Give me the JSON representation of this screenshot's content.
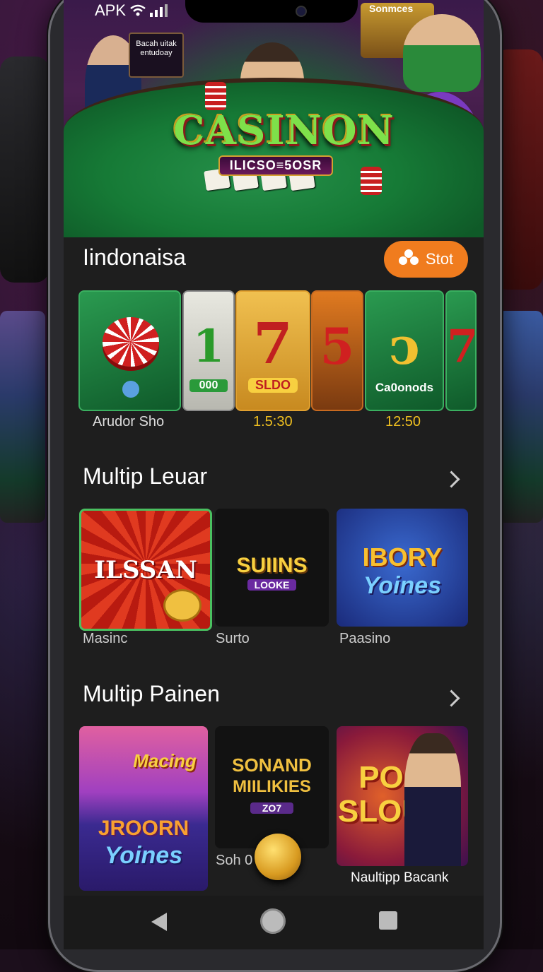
{
  "status_bar": {
    "label": "APK"
  },
  "hero": {
    "logo_title": "CASINON",
    "logo_subtitle": "ILICSO≡5OSR",
    "sign_left": "Bacah uitak entudoay",
    "sign_right": "Sonmces"
  },
  "section1": {
    "title": "Iindonaisa",
    "action_label": "Stot",
    "tiles": [
      {
        "caption_inner": "",
        "label": "Arudor Sho"
      },
      {
        "caption_inner": "000",
        "label": ""
      },
      {
        "caption_inner": "SLDO",
        "label": "1.5:30"
      },
      {
        "caption_inner": "",
        "label": ""
      },
      {
        "caption_inner": "Ca0onods",
        "label": "12:50"
      }
    ],
    "reel_digits": [
      "1",
      "7",
      "5",
      "ↄ",
      "7"
    ]
  },
  "section2": {
    "title": "Multip Leuar",
    "tiles": [
      {
        "art_text": "ILSSAN",
        "label": "Masinc"
      },
      {
        "art_text": "SUIINS",
        "art_sub": "LOOKE",
        "label": "Surto"
      },
      {
        "art_text": "IBORY",
        "art_sub": "Yoines",
        "label": "Paasino"
      }
    ]
  },
  "section3": {
    "title": "Multip Painen",
    "tiles": [
      {
        "art_text": "Macing",
        "art_sub": "JROORN",
        "art_sub2": "Yoines",
        "label": ""
      },
      {
        "art_text": "SONAND",
        "art_sub": "MIILIKIES",
        "art_sub2": "ZO7",
        "label": "Soh 0"
      },
      {
        "art_text": "PO",
        "art_sub": "SLOU",
        "label": "Naultipp Bacank"
      }
    ]
  },
  "colors": {
    "accent": "#f07c1e",
    "screen_bg": "#1e1e1e",
    "felt": "#167a36"
  },
  "icons": [
    "wifi-icon",
    "signal-icon",
    "stot-icon",
    "chevron-right-icon",
    "back-icon",
    "home-icon",
    "recents-icon"
  ]
}
